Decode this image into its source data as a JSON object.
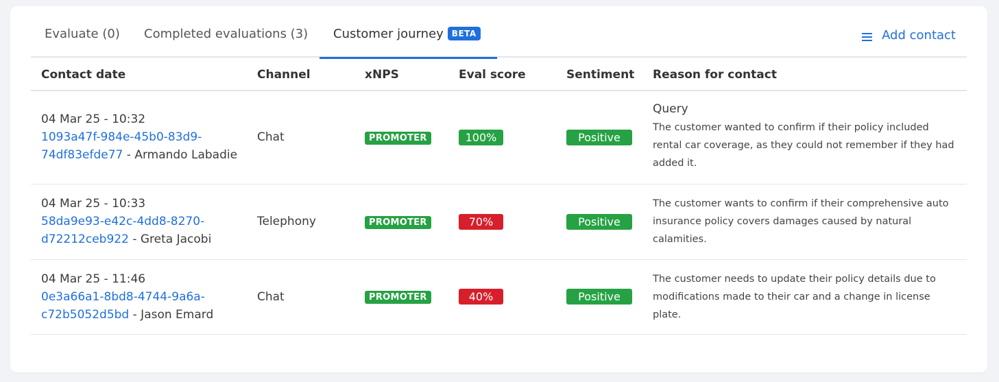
{
  "tabs": [
    {
      "label": "Evaluate (0)"
    },
    {
      "label": "Completed evaluations (3)"
    },
    {
      "label": "Customer journey",
      "badge": "BETA"
    }
  ],
  "add_contact_label": "Add contact",
  "columns": [
    "Contact date",
    "Channel",
    "xNPS",
    "Eval score",
    "Sentiment",
    "Reason for contact"
  ],
  "rows": [
    {
      "date": "04 Mar 25 - 10:32",
      "id_line1": "1093a47f-984e-45b0-83d9-",
      "id_line2": "74df83efde77",
      "agent": " - Armando Labadie",
      "channel": "Chat",
      "xnps": "PROMOTER",
      "score": "100%",
      "sentiment": "Positive",
      "reason_title": "Query",
      "reason": "The customer wanted to confirm if their policy included rental car coverage, as they could not remember if they had added it."
    },
    {
      "date": "04 Mar 25 - 10:33",
      "id_line1": "58da9e93-e42c-4dd8-8270-",
      "id_line2": "d72212ceb922",
      "agent": " - Greta Jacobi",
      "channel": "Telephony",
      "xnps": "PROMOTER",
      "score": "70%",
      "sentiment": "Positive",
      "reason_title": "",
      "reason": "The customer wants to confirm if their comprehensive auto insurance policy covers damages caused by natural calamities."
    },
    {
      "date": "04 Mar 25 - 11:46",
      "id_line1": "0e3a66a1-8bd8-4744-9a6a-",
      "id_line2": "c72b5052d5bd",
      "agent": " - Jason Emard",
      "channel": "Chat",
      "xnps": "PROMOTER",
      "score": "40%",
      "sentiment": "Positive",
      "reason_title": "",
      "reason": "The customer needs to update their policy details due to modifications made to their car and a change in license plate."
    }
  ],
  "colors": {
    "accent": "#1f6fde",
    "positive": "#26a244",
    "score_high": "#26a244",
    "score_low": "#d71f2b"
  },
  "icons": {
    "add_contact": "list-icon"
  }
}
